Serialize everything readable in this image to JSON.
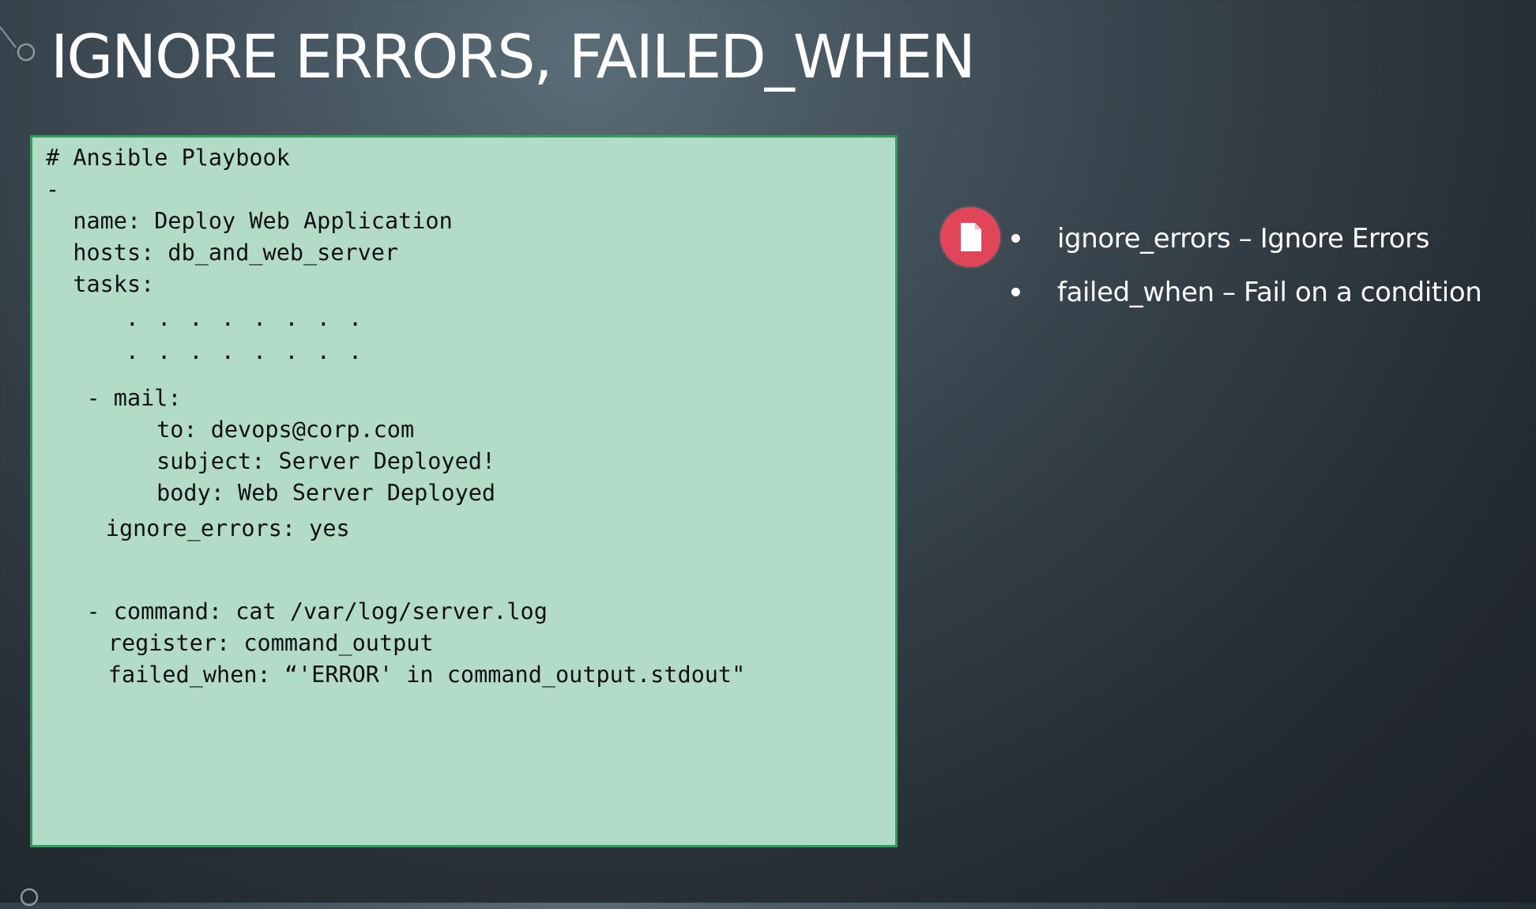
{
  "slide": {
    "title": "IGNORE ERRORS, FAILED_WHEN"
  },
  "code": {
    "lines": [
      "# Ansible Playbook",
      "-",
      "  name: Deploy Web Application",
      "  hosts: db_and_web_server",
      "  tasks:",
      "     . . . . . . . .",
      "     . . . . . . . .",
      "   - mail:",
      "       to: devops@corp.com",
      "       subject: Server Deployed!",
      "       body: Web Server Deployed",
      "     ignore_errors: yes",
      "   - command: cat /var/log/server.log",
      "     register: command_output",
      "     failed_when: “'ERROR' in command_output.stdout\""
    ]
  },
  "bullets": {
    "items": [
      "ignore_errors – Ignore Errors",
      "failed_when – Fail on a condition"
    ]
  },
  "icons": {
    "badge": "document-icon",
    "badge_color": "#e04558"
  },
  "colors": {
    "code_background": "#b2dcc8",
    "code_border": "#2e9e5a"
  }
}
